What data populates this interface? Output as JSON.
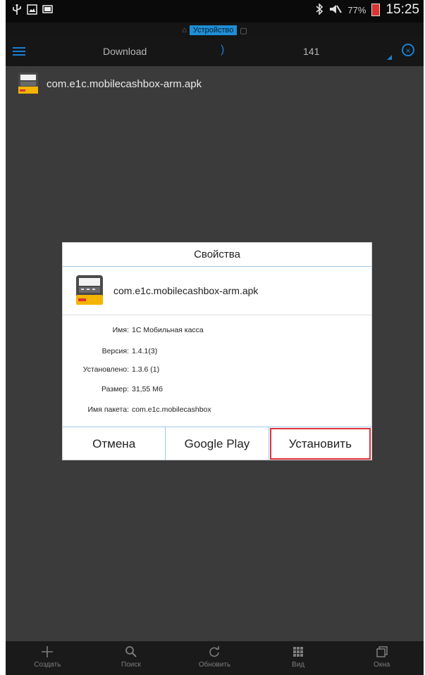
{
  "statusbar": {
    "battery": "77%",
    "time": "15:25",
    "icons_left": [
      "usb-icon",
      "screenshot-icon",
      "device-icon"
    ],
    "icons_right": [
      "bluetooth-icon",
      "mute-icon",
      "battery-icon"
    ]
  },
  "location": {
    "label": "Устройство"
  },
  "toolbar": {
    "folder": "Download",
    "separator": ")",
    "count": "141"
  },
  "files": [
    {
      "name": "com.e1c.mobilecashbox-arm.apk",
      "icon": "apk-cashbox-icon"
    }
  ],
  "dialog": {
    "title": "Свойства",
    "file_name": "com.e1c.mobilecashbox-arm.apk",
    "properties": [
      {
        "key": "Имя:",
        "value": "1С Мобильная касса"
      },
      {
        "key": "Версия:",
        "value": "1.4.1(3)"
      },
      {
        "key": "Установлено:",
        "value": "1.3.6 (1)"
      },
      {
        "key": "Размер:",
        "value": "31,55 Мб"
      },
      {
        "key": "Имя пакета:",
        "value": "com.e1c.mobilecashbox"
      }
    ],
    "buttons": {
      "cancel": "Отмена",
      "google_play": "Google Play",
      "install": "Установить"
    },
    "highlight_color": "#e0323a"
  },
  "bottombar": {
    "items": [
      {
        "label": "Создать",
        "icon": "plus-icon"
      },
      {
        "label": "Поиск",
        "icon": "search-icon"
      },
      {
        "label": "Обновить",
        "icon": "refresh-icon"
      },
      {
        "label": "Вид",
        "icon": "grid-icon"
      },
      {
        "label": "Окна",
        "icon": "windows-icon"
      }
    ]
  },
  "colors": {
    "accent": "#1b7fd0",
    "background": "#3b3b3b"
  }
}
